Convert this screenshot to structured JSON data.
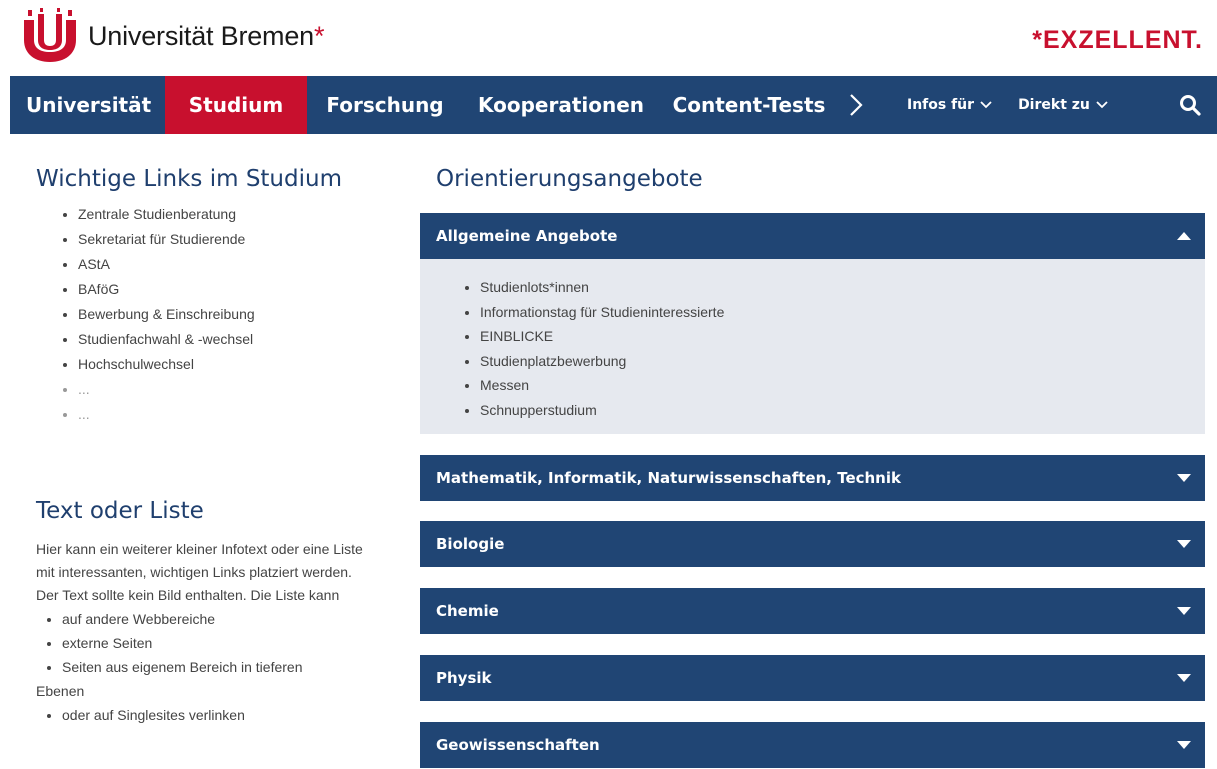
{
  "header": {
    "logo_text": "Universität Bremen",
    "logo_star": "*",
    "tagline": "*EXZELLENT.",
    "brand_red": "#c8102e",
    "brand_blue": "#204574"
  },
  "nav": {
    "items": [
      {
        "label": "Universität"
      },
      {
        "label": "Studium"
      },
      {
        "label": "Forschung"
      },
      {
        "label": "Kooperationen"
      },
      {
        "label": "Content-Tests"
      }
    ],
    "infos_label": "Infos für",
    "direkt_label": "Direkt zu"
  },
  "left": {
    "links_title": "Wichtige Links im Studium",
    "links": [
      "Zentrale Studienberatung",
      "Sekretariat für Studierende",
      "AStA",
      "BAföG",
      "Bewerbung & Einschreibung",
      "Studienfachwahl & -wechsel",
      "Hochschulwechsel",
      "...",
      "..."
    ],
    "text_title": "Text oder Liste",
    "text_paragraph": "Hier kann ein weiterer kleiner Infotext oder eine Liste mit interessanten, wichtigen Links platziert werden. Der Text sollte kein Bild enthalten. Die Liste kann",
    "text_list": [
      "auf andere Webbereiche",
      "externe Seiten",
      "Seiten aus eigenem Bereich in tieferen",
      "oder auf Singlesites verlinken"
    ],
    "text_list_continuation": "Ebenen"
  },
  "right": {
    "title": "Orientierungsangebote",
    "accordions": [
      {
        "label": "Allgemeine Angebote",
        "expanded": true,
        "items": [
          "Studienlots*innen",
          "Informationstag für Studieninteressierte",
          "EINBLICKE",
          "Studienplatzbewerbung",
          "Messen",
          "Schnupperstudium"
        ]
      },
      {
        "label": "Mathematik, Informatik, Naturwissenschaften, Technik",
        "expanded": false
      },
      {
        "label": "Biologie",
        "expanded": false
      },
      {
        "label": "Chemie",
        "expanded": false
      },
      {
        "label": "Physik",
        "expanded": false
      },
      {
        "label": "Geowissenschaften",
        "expanded": false
      }
    ]
  }
}
